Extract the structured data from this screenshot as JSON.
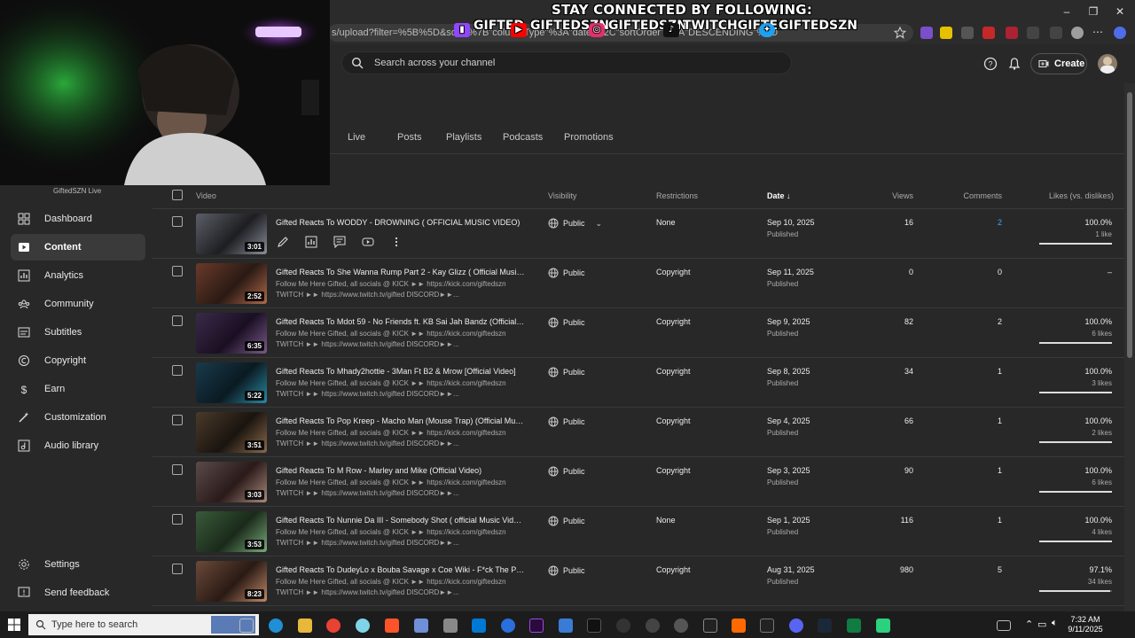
{
  "browser": {
    "url": "s/upload?filter=%5B%5D&sort=%7B\"columnType\"%3A\"date\"%2C\"sortOrder\"%3A\"DESCENDING\"%7D",
    "window_minimize": "–",
    "window_maximize": "❐",
    "window_close": "✕"
  },
  "overlay": {
    "title": "STAY CONNECTED BY FOLLOWING:",
    "socials": [
      {
        "name": "GIFTED",
        "icon": "twitch-icon",
        "color": "#9146ff"
      },
      {
        "name": "GIFTEDSZN",
        "icon": "youtube-icon",
        "color": "#ff0000"
      },
      {
        "name": "GIFTEDSZN",
        "icon": "instagram-icon",
        "color": "#e1306c"
      },
      {
        "name": "TWITCHGIFTED",
        "icon": "tiktok-icon",
        "color": "#111111"
      },
      {
        "name": "GIFTEDSZN",
        "icon": "twitter-icon",
        "color": "#1da1f2"
      }
    ]
  },
  "header": {
    "search_placeholder": "Search across your channel",
    "create_label": "Create"
  },
  "tabs": [
    "Live",
    "Posts",
    "Playlists",
    "Podcasts",
    "Promotions"
  ],
  "sidebar": {
    "channel_label": "GiftedSZN Live",
    "items": [
      {
        "label": "Dashboard",
        "icon": "dashboard-icon",
        "active": false
      },
      {
        "label": "Content",
        "icon": "content-icon",
        "active": true
      },
      {
        "label": "Analytics",
        "icon": "analytics-icon",
        "active": false
      },
      {
        "label": "Community",
        "icon": "community-icon",
        "active": false
      },
      {
        "label": "Subtitles",
        "icon": "subtitles-icon",
        "active": false
      },
      {
        "label": "Copyright",
        "icon": "copyright-icon",
        "active": false
      },
      {
        "label": "Earn",
        "icon": "earn-icon",
        "active": false
      },
      {
        "label": "Customization",
        "icon": "customization-icon",
        "active": false
      },
      {
        "label": "Audio library",
        "icon": "audio-library-icon",
        "active": false
      }
    ],
    "bottom_items": [
      {
        "label": "Settings",
        "icon": "settings-icon"
      },
      {
        "label": "Send feedback",
        "icon": "feedback-icon"
      }
    ]
  },
  "table": {
    "headers": {
      "video": "Video",
      "visibility": "Visibility",
      "restrictions": "Restrictions",
      "date": "Date",
      "views": "Views",
      "comments": "Comments",
      "likes": "Likes (vs. dislikes)"
    },
    "rows": [
      {
        "title": "Gifted Reacts To WODDY - DROWNING ( OFFICIAL MUSIC VIDEO)",
        "desc1": "",
        "desc2": "",
        "duration": "3:01",
        "visibility": "Public",
        "restrictions": "None",
        "date": "Sep 10, 2025",
        "status": "Published",
        "views": "16",
        "comments": "2",
        "likes": "100.0%",
        "like_count": "1 like",
        "like_fraction": 1.0,
        "hover": true
      },
      {
        "title": "Gifted Reacts To She Wanna Rump Part 2 - Kay Glizz ( Official Music Vi...",
        "desc1": "Follow Me Here Gifted, all socials @ KICK ►► https://kick.com/giftedszn",
        "desc2": "TWITCH ►► https://www.twitch.tv/gifted DISCORD►►...",
        "duration": "2:52",
        "visibility": "Public",
        "restrictions": "Copyright",
        "date": "Sep 11, 2025",
        "status": "Published",
        "views": "0",
        "comments": "0",
        "likes": "–",
        "like_count": "",
        "like_fraction": 0,
        "hover": false
      },
      {
        "title": "Gifted Reacts To Mdot 59 - No Friends ft. KB Sai Jah Bandz (Official Vid...",
        "desc1": "Follow Me Here Gifted, all socials @ KICK ►► https://kick.com/giftedszn",
        "desc2": "TWITCH ►► https://www.twitch.tv/gifted DISCORD►►...",
        "duration": "6:35",
        "visibility": "Public",
        "restrictions": "Copyright",
        "date": "Sep 9, 2025",
        "status": "Published",
        "views": "82",
        "comments": "2",
        "likes": "100.0%",
        "like_count": "6 likes",
        "like_fraction": 1.0,
        "hover": false
      },
      {
        "title": "Gifted Reacts To Mhady2hottie - 3Man Ft B2 & Mrow [Official Video]",
        "desc1": "Follow Me Here Gifted, all socials @ KICK ►► https://kick.com/giftedszn",
        "desc2": "TWITCH ►► https://www.twitch.tv/gifted DISCORD►►...",
        "duration": "5:22",
        "visibility": "Public",
        "restrictions": "Copyright",
        "date": "Sep 8, 2025",
        "status": "Published",
        "views": "34",
        "comments": "1",
        "likes": "100.0%",
        "like_count": "3 likes",
        "like_fraction": 1.0,
        "hover": false
      },
      {
        "title": "Gifted Reacts To Pop Kreep - Macho Man (Mouse Trap) (Official Music ...",
        "desc1": "Follow Me Here Gifted, all socials @ KICK ►► https://kick.com/giftedszn",
        "desc2": "TWITCH ►► https://www.twitch.tv/gifted DISCORD►►...",
        "duration": "3:51",
        "visibility": "Public",
        "restrictions": "Copyright",
        "date": "Sep 4, 2025",
        "status": "Published",
        "views": "66",
        "comments": "1",
        "likes": "100.0%",
        "like_count": "2 likes",
        "like_fraction": 1.0,
        "hover": false
      },
      {
        "title": "Gifted Reacts To M Row - Marley and Mike (Official Video)",
        "desc1": "Follow Me Here Gifted, all socials @ KICK ►► https://kick.com/giftedszn",
        "desc2": "TWITCH ►► https://www.twitch.tv/gifted DISCORD►►...",
        "duration": "3:03",
        "visibility": "Public",
        "restrictions": "Copyright",
        "date": "Sep 3, 2025",
        "status": "Published",
        "views": "90",
        "comments": "1",
        "likes": "100.0%",
        "like_count": "6 likes",
        "like_fraction": 1.0,
        "hover": false
      },
      {
        "title": "Gifted Reacts To Nunnie Da III - Somebody Shot ( official Music Video )",
        "desc1": "Follow Me Here Gifted, all socials @ KICK ►► https://kick.com/giftedszn",
        "desc2": "TWITCH ►► https://www.twitch.tv/gifted DISCORD►►...",
        "duration": "3:53",
        "visibility": "Public",
        "restrictions": "None",
        "date": "Sep 1, 2025",
        "status": "Published",
        "views": "116",
        "comments": "1",
        "likes": "100.0%",
        "like_count": "4 likes",
        "like_fraction": 1.0,
        "hover": false
      },
      {
        "title": "Gifted Reacts To DudeyLo x Bouba Savage x Coe Wiki - F*ck The Politic...",
        "desc1": "Follow Me Here Gifted, all socials @ KICK ►► https://kick.com/giftedszn",
        "desc2": "TWITCH ►► https://www.twitch.tv/gifted DISCORD►►...",
        "duration": "8:23",
        "visibility": "Public",
        "restrictions": "Copyright",
        "date": "Aug 31, 2025",
        "status": "Published",
        "views": "980",
        "comments": "5",
        "likes": "97.1%",
        "like_count": "34 likes",
        "like_fraction": 0.971,
        "hover": false
      }
    ]
  },
  "taskbar": {
    "search_placeholder": "Type here to search",
    "time": "7:32 AM",
    "date": "9/11/2025"
  }
}
